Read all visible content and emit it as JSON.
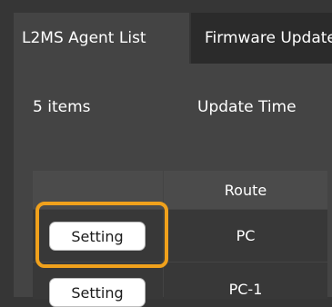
{
  "tabs": [
    {
      "label": "L2MS Agent List",
      "active": true
    },
    {
      "label": "Firmware Update",
      "active": false
    }
  ],
  "summary": {
    "item_count": "5 items",
    "update_time_label": "Update Time"
  },
  "table": {
    "headers": [
      "",
      "Route"
    ],
    "rows": [
      {
        "action": "Setting",
        "route": "PC"
      },
      {
        "action": "Setting",
        "route": "PC-1"
      }
    ]
  },
  "colors": {
    "highlight": "#f0a11c",
    "background": "#363636",
    "panel": "#444444"
  }
}
